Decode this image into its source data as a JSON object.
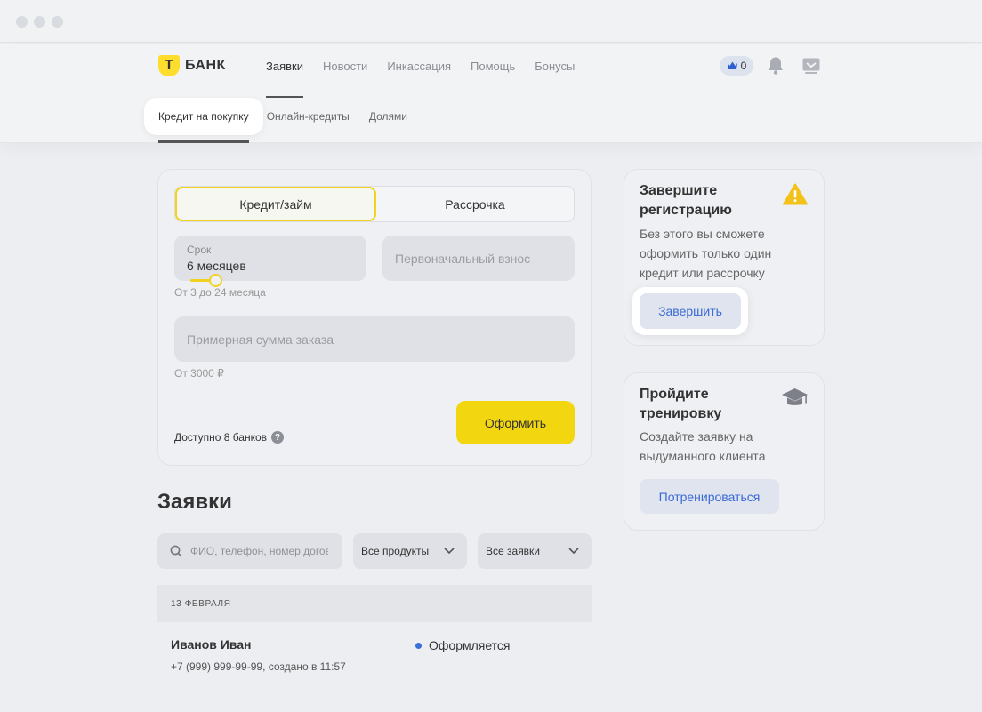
{
  "brand": {
    "logo_letter": "Т",
    "name": "БАНК",
    "accent": "#ffdd2d"
  },
  "nav": {
    "items": [
      "Заявки",
      "Новости",
      "Инкассация",
      "Помощь",
      "Бонусы"
    ],
    "active": "Заявки",
    "crown_count": "0"
  },
  "subnav": {
    "items": [
      "Кредит на покупку",
      "Онлайн-кредиты",
      "Долями"
    ],
    "active": "Кредит на покупку"
  },
  "form": {
    "tabs": [
      "Кредит/займ",
      "Рассрочка"
    ],
    "selected_tab": "Кредит/займ",
    "term_label": "Срок",
    "term_value": "6 месяцев",
    "term_hint": "От 3 до 24 месяца",
    "down_payment_placeholder": "Первоначальный взнос",
    "amount_placeholder": "Примерная сумма заказа",
    "amount_hint": "От 3000 ₽",
    "banks_text": "Доступно 8 банков",
    "submit_label": "Оформить"
  },
  "applications": {
    "title": "Заявки",
    "search_placeholder": "ФИО, телефон, номер договора",
    "filter_products": "Все продукты",
    "filter_status": "Все заявки",
    "date_header": "13 ФЕВРАЛЯ",
    "items": [
      {
        "name": "Иванов Иван",
        "meta": "+7 (999) 999-99-99, создано в 11:57",
        "status": "Оформляется",
        "status_color": "#3a6fd8"
      }
    ]
  },
  "sidebar": {
    "registration": {
      "title": "Завершите регистрацию",
      "text": "Без этого вы сможете оформить только один кредит или рассрочку",
      "button": "Завершить",
      "icon": "warning-icon"
    },
    "training": {
      "title": "Пройдите тренировку",
      "text": "Создайте заявку на выдуманного клиента",
      "button": "Потренироваться",
      "icon": "graduation-cap-icon"
    }
  }
}
